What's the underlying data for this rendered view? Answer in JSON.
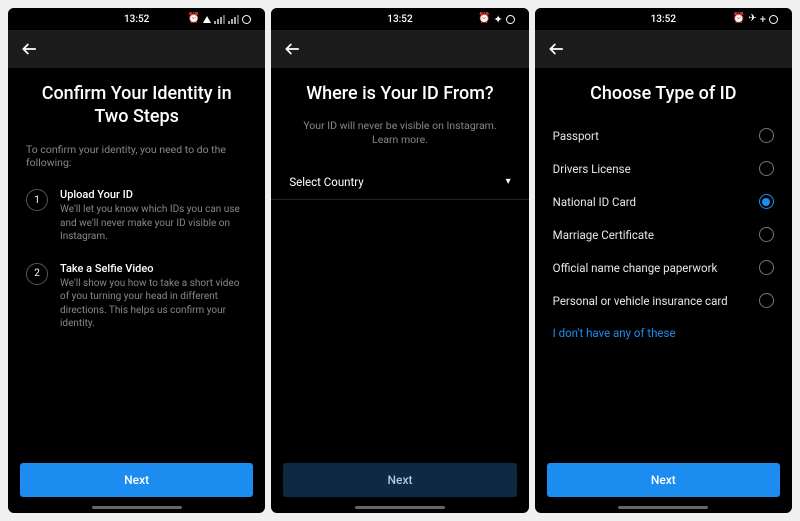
{
  "status": {
    "time": "13:52"
  },
  "screen1": {
    "title": "Confirm Your Identity in Two Steps",
    "subtitle": "To confirm your identity, you need to do the following:",
    "step1_num": "1",
    "step1_title": "Upload Your ID",
    "step1_desc": "We'll let you know which IDs you can use and we'll never make your ID visible on Instagram.",
    "step2_num": "2",
    "step2_title": "Take a Selfie Video",
    "step2_desc": "We'll show you how to take a short video of you turning your head in different directions. This helps us confirm your identity.",
    "next": "Next"
  },
  "screen2": {
    "title": "Where is Your ID From?",
    "subtitle": "Your ID will never be visible on Instagram. Learn more.",
    "select_label": "Select Country",
    "next": "Next"
  },
  "screen3": {
    "title": "Choose Type of ID",
    "options": {
      "o0": "Passport",
      "o1": "Drivers License",
      "o2": "National ID Card",
      "o3": "Marriage Certificate",
      "o4": "Official name change paperwork",
      "o5": "Personal or vehicle insurance card"
    },
    "selected_index": 2,
    "none_link": "I don't have any of these",
    "next": "Next"
  },
  "colors": {
    "accent": "#1c8cf0",
    "bg": "#000000"
  }
}
